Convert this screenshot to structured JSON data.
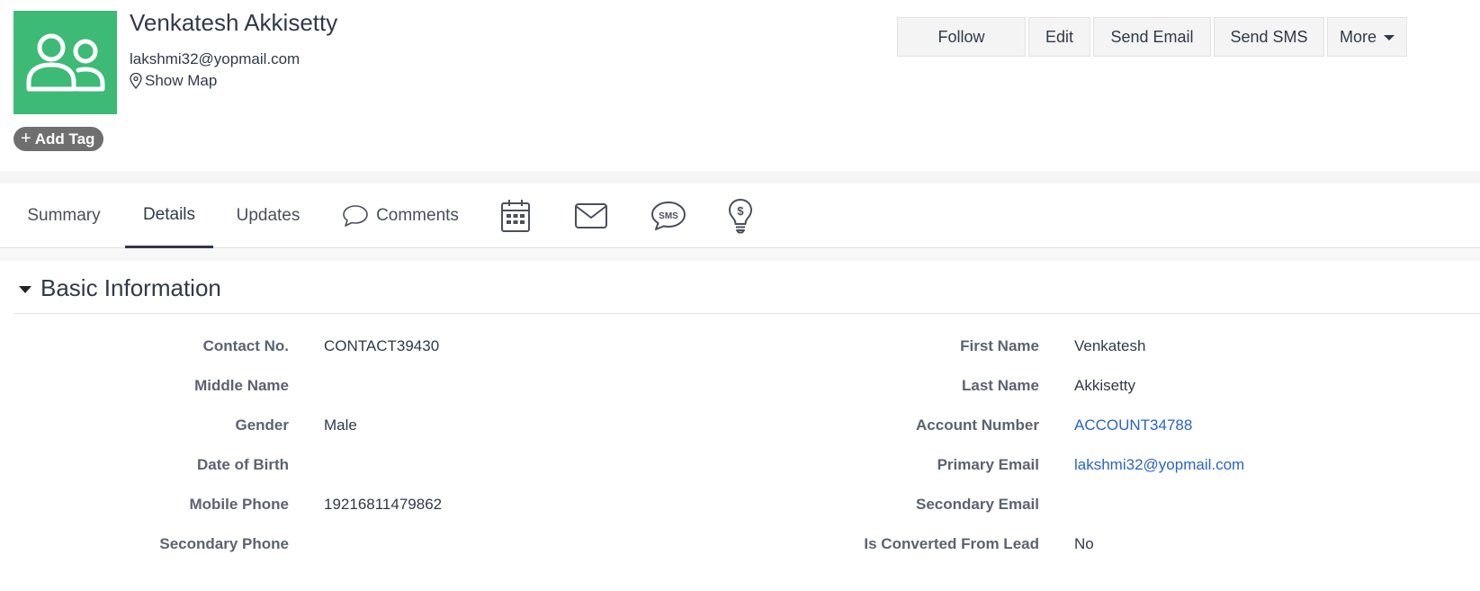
{
  "record": {
    "name": "Venkatesh Akkisetty",
    "email": "lakshmi32@yopmail.com",
    "show_map": "Show Map",
    "add_tag": "Add Tag"
  },
  "actions": {
    "follow": "Follow",
    "edit": "Edit",
    "send_email": "Send Email",
    "send_sms": "Send SMS",
    "more": "More"
  },
  "tabs": {
    "summary": "Summary",
    "details": "Details",
    "updates": "Updates",
    "comments": "Comments",
    "active": "Details",
    "icons": [
      "calendar-icon",
      "mail-icon",
      "sms-icon",
      "deal-bulb-icon"
    ]
  },
  "section": {
    "title": "Basic Information"
  },
  "fields": {
    "left": [
      {
        "label": "Contact No.",
        "value": "CONTACT39430"
      },
      {
        "label": "Middle Name",
        "value": ""
      },
      {
        "label": "Gender",
        "value": "Male"
      },
      {
        "label": "Date of Birth",
        "value": ""
      },
      {
        "label": "Mobile Phone",
        "value": "19216811479862"
      },
      {
        "label": "Secondary Phone",
        "value": ""
      }
    ],
    "right": [
      {
        "label": "First Name",
        "value": "Venkatesh"
      },
      {
        "label": "Last Name",
        "value": "Akkisetty"
      },
      {
        "label": "Account Number",
        "value": "ACCOUNT34788"
      },
      {
        "label": "Primary Email",
        "value": "lakshmi32@yopmail.com"
      },
      {
        "label": "Secondary Email",
        "value": ""
      },
      {
        "label": "Is Converted From Lead",
        "value": "No"
      }
    ]
  },
  "colors": {
    "avatar_bg": "#3dba76",
    "link": "#2a63c8",
    "tag_bg": "#6f6f6f"
  }
}
